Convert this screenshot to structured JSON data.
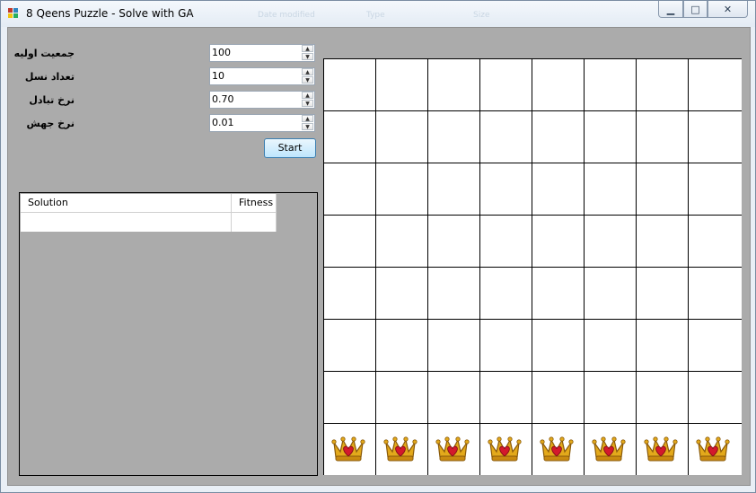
{
  "window": {
    "title": "8 Qeens Puzzle - Solve with GA",
    "faded_text": [
      "Date modified",
      "Type",
      "Size"
    ]
  },
  "params": [
    {
      "label": "جمعیت اولیه",
      "value": "100"
    },
    {
      "label": "تعداد نسل",
      "value": "10"
    },
    {
      "label": "نرخ تبادل",
      "value": "0.70"
    },
    {
      "label": "نرخ جهش",
      "value": "0.01"
    }
  ],
  "start_label": "Start",
  "grid": {
    "columns": [
      "Solution",
      "Fitness"
    ]
  },
  "board": {
    "size": 8,
    "queen_row": 8,
    "queen_columns": [
      1,
      2,
      3,
      4,
      5,
      6,
      7,
      8
    ]
  },
  "colors": {
    "client_bg": "#ababab",
    "crown_gold": "#e3a91b",
    "heart_red": "#d3192c"
  }
}
